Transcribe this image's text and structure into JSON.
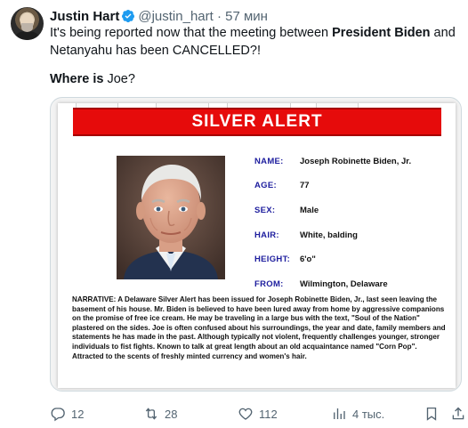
{
  "tweet": {
    "author": "Justin Hart",
    "handle": "@justin_hart",
    "separator": "·",
    "time": "57 мин",
    "text_part1": "It's being reported now that the meeting between ",
    "text_bold": "President Biden",
    "text_part2": " and",
    "text_line2": "Netanyahu has been CANCELLED?!",
    "where_bold": "Where is",
    "where_rest": " Joe?"
  },
  "poster": {
    "banner": "SILVER ALERT",
    "fields": [
      {
        "label": "NAME:",
        "value": "Joseph Robinette Biden, Jr."
      },
      {
        "label": "AGE:",
        "value": "77"
      },
      {
        "label": "SEX:",
        "value": "Male"
      },
      {
        "label": "HAIR:",
        "value": "White, balding"
      },
      {
        "label": "HEIGHT:",
        "value": "6'o\""
      },
      {
        "label": "FROM:",
        "value": "Wilmington, Delaware"
      }
    ],
    "narrative_label": "NARRATIVE:",
    "narrative_text": " A Delaware Silver Alert has been issued for Joseph Robinette Biden, Jr., last seen leaving the basement of his house. Mr. Biden is believed to have been lured away from home by aggressive companions on the promise of free ice cream. He may be traveling in a large bus with the text, \"Soul of the Nation\" plastered on the sides. Joe is often confused about his surroundings, the year and date, family members and statements he has made in the past. Although typically not violent, frequently challenges younger, stronger individuals to fist fights. Known to talk at great length about an old acquaintance named \"Corn Pop\". Attracted to the scents of freshly minted currency and women's hair."
  },
  "actions": {
    "replies": "12",
    "reposts": "28",
    "likes": "112",
    "views": "4 тыс."
  },
  "colors": {
    "banner_red": "#e60b0b",
    "label_blue": "#1d1d9e",
    "verified_blue": "#1d9bf0",
    "muted": "#536471"
  }
}
